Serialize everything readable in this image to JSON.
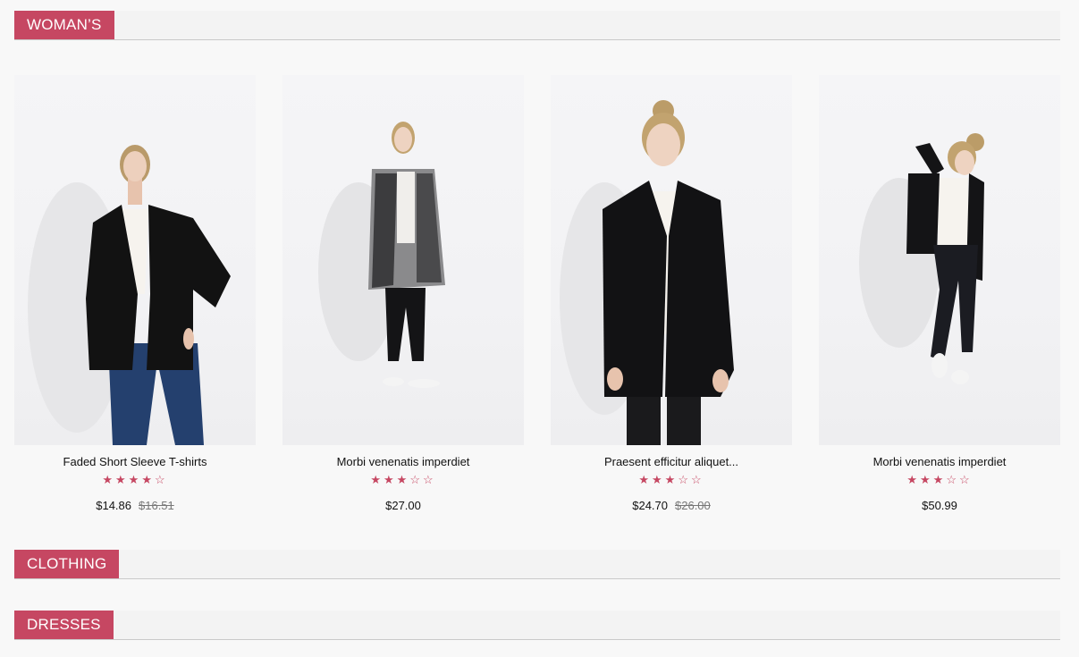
{
  "sections": {
    "womans": {
      "title": "WOMAN’S"
    },
    "clothing": {
      "title": "CLOTHING"
    },
    "dresses": {
      "title": "DRESSES"
    }
  },
  "products": [
    {
      "name": "Faded Short Sleeve T-shirts",
      "rating": 4,
      "rating_max": 5,
      "price": "$14.86",
      "old_price": "$16.51"
    },
    {
      "name": "Morbi venenatis imperdiet",
      "rating": 3,
      "rating_max": 5,
      "price": "$27.00",
      "old_price": ""
    },
    {
      "name": "Praesent efficitur aliquet...",
      "rating": 3,
      "rating_max": 5,
      "price": "$24.70",
      "old_price": "$26.00"
    },
    {
      "name": "Morbi venenatis imperdiet",
      "rating": 3,
      "rating_max": 5,
      "price": "$50.99",
      "old_price": ""
    }
  ],
  "colors": {
    "accent": "#c64762",
    "bar_bg": "#f3f3f3",
    "page_bg": "#f8f8f8"
  },
  "icons": {
    "star_filled": "star-filled-icon",
    "star_empty": "star-empty-icon"
  }
}
